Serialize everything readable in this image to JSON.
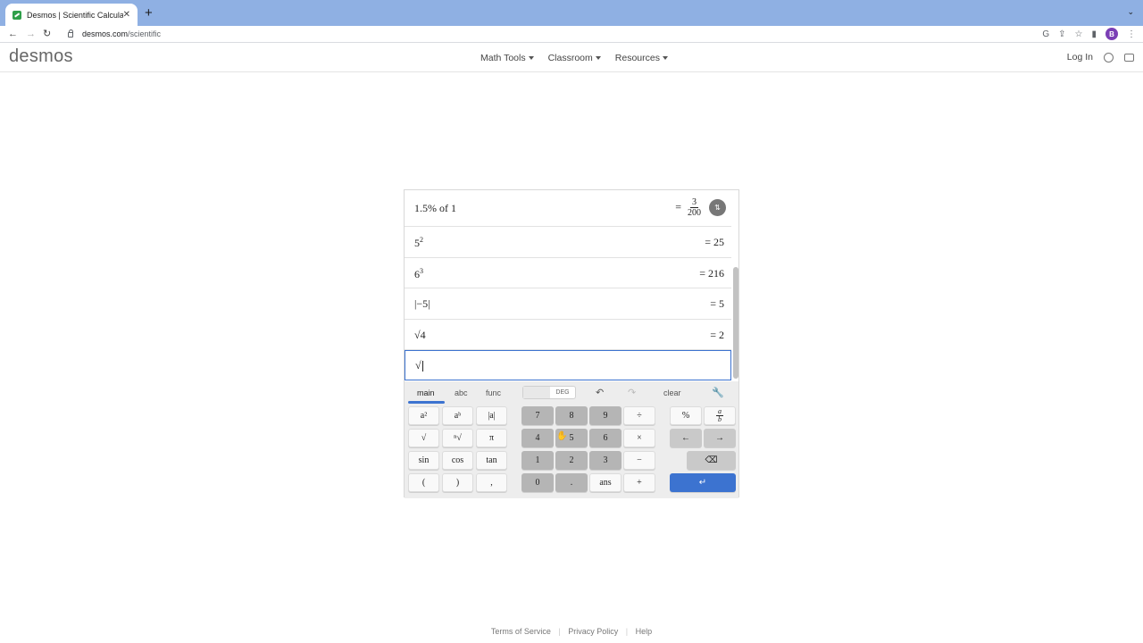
{
  "browser": {
    "tab_title": "Desmos | Scientific Calculator",
    "tab_close": "✕",
    "new_tab": "+",
    "tab_menu": "⌄",
    "url_domain": "desmos.com",
    "url_path": "/scientific",
    "nav": {
      "back": "←",
      "forward": "→",
      "reload": "↻"
    },
    "profile_initial": "B"
  },
  "header": {
    "logo": "desmos",
    "nav": [
      "Math Tools",
      "Classroom",
      "Resources"
    ],
    "login": "Log In"
  },
  "expressions": [
    {
      "lhs": "1.5% of 1",
      "rhs_prefix": "=",
      "rhs_num": "3",
      "rhs_den": "200",
      "toggle": "⇅"
    },
    {
      "lhs_base": "5",
      "lhs_exp": "2",
      "rhs": "= 25"
    },
    {
      "lhs_base": "6",
      "lhs_exp": "3",
      "rhs": "= 216"
    },
    {
      "lhs": "|−5|",
      "rhs": "= 5"
    },
    {
      "lhs": "√4",
      "rhs": "= 2"
    },
    {
      "lhs": "√"
    }
  ],
  "keypad": {
    "tabs": [
      "main",
      "abc",
      "func"
    ],
    "angle_mode": "DEG",
    "clear": "clear",
    "left_keys": [
      [
        "a²",
        "aᵇ",
        "|a|"
      ],
      [
        "√",
        "ⁿ√",
        "π"
      ],
      [
        "sin",
        "cos",
        "tan"
      ],
      [
        "(",
        ")",
        ","
      ]
    ],
    "number_keys": [
      [
        "7",
        "8",
        "9",
        "÷"
      ],
      [
        "4",
        "5",
        "6",
        "×"
      ],
      [
        "1",
        "2",
        "3",
        "−"
      ],
      [
        "0",
        ".",
        "ans",
        "+"
      ]
    ],
    "right_keys": {
      "percent": "%",
      "fraction_num": "a",
      "fraction_den": "b",
      "left_arrow": "←",
      "right_arrow": "→",
      "enter": "↵"
    }
  },
  "footer": {
    "links": [
      "Terms of Service",
      "Privacy Policy",
      "Help"
    ]
  },
  "colors": {
    "accent": "#3c73d0",
    "tabbar": "#8fb0e3"
  }
}
